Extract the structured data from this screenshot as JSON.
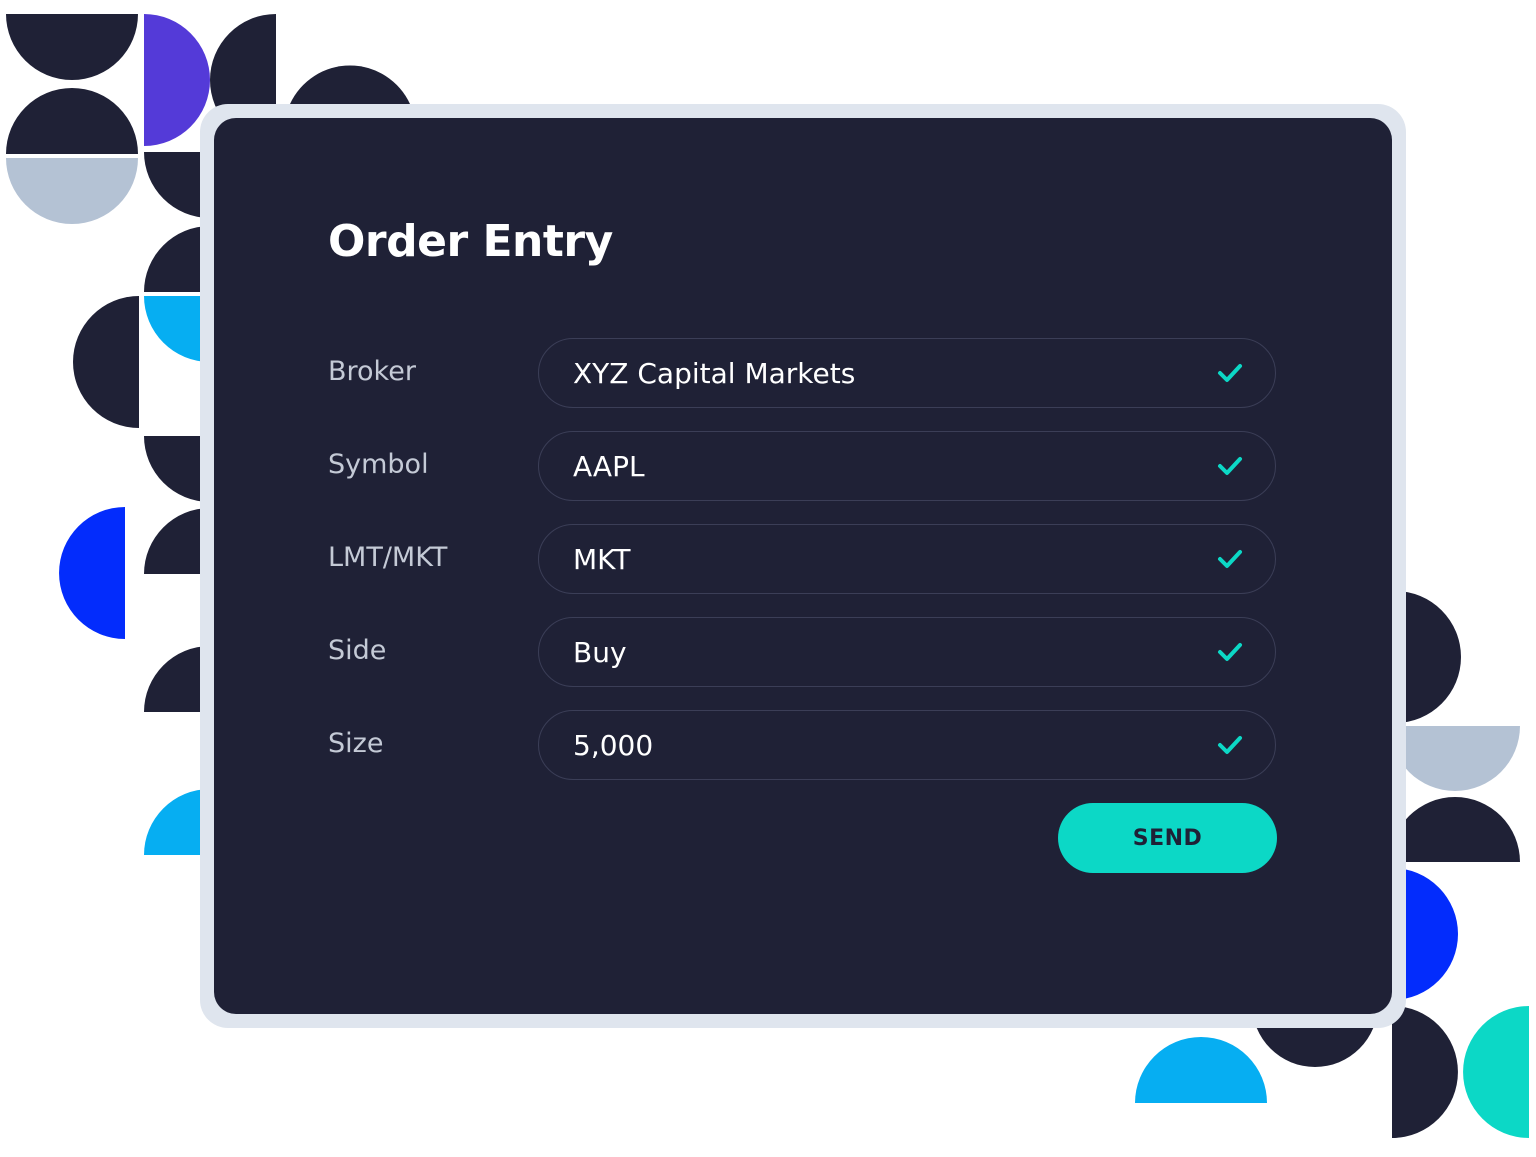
{
  "title": "Order Entry",
  "form": {
    "fields": [
      {
        "label": "Broker",
        "value": "XYZ Capital Markets",
        "status_icon": "check-icon"
      },
      {
        "label": "Symbol",
        "value": "AAPL",
        "status_icon": "check-icon"
      },
      {
        "label": "LMT/MKT",
        "value": "MKT",
        "status_icon": "check-icon"
      },
      {
        "label": "Side",
        "value": "Buy",
        "status_icon": "check-icon"
      },
      {
        "label": "Size",
        "value": "5,000",
        "status_icon": "check-icon"
      }
    ],
    "send_label": "SEND"
  },
  "colors": {
    "card_background": "#1f2136",
    "card_border": "#dfe5ee",
    "accent": "#0cd8c6",
    "decor_navy": "#1f2136",
    "decor_purple": "#543ad8",
    "decor_sky": "#06aef2",
    "decor_blue": "#032cfc",
    "decor_gray": "#b4c2d4",
    "decor_teal": "#0cd8c6"
  }
}
